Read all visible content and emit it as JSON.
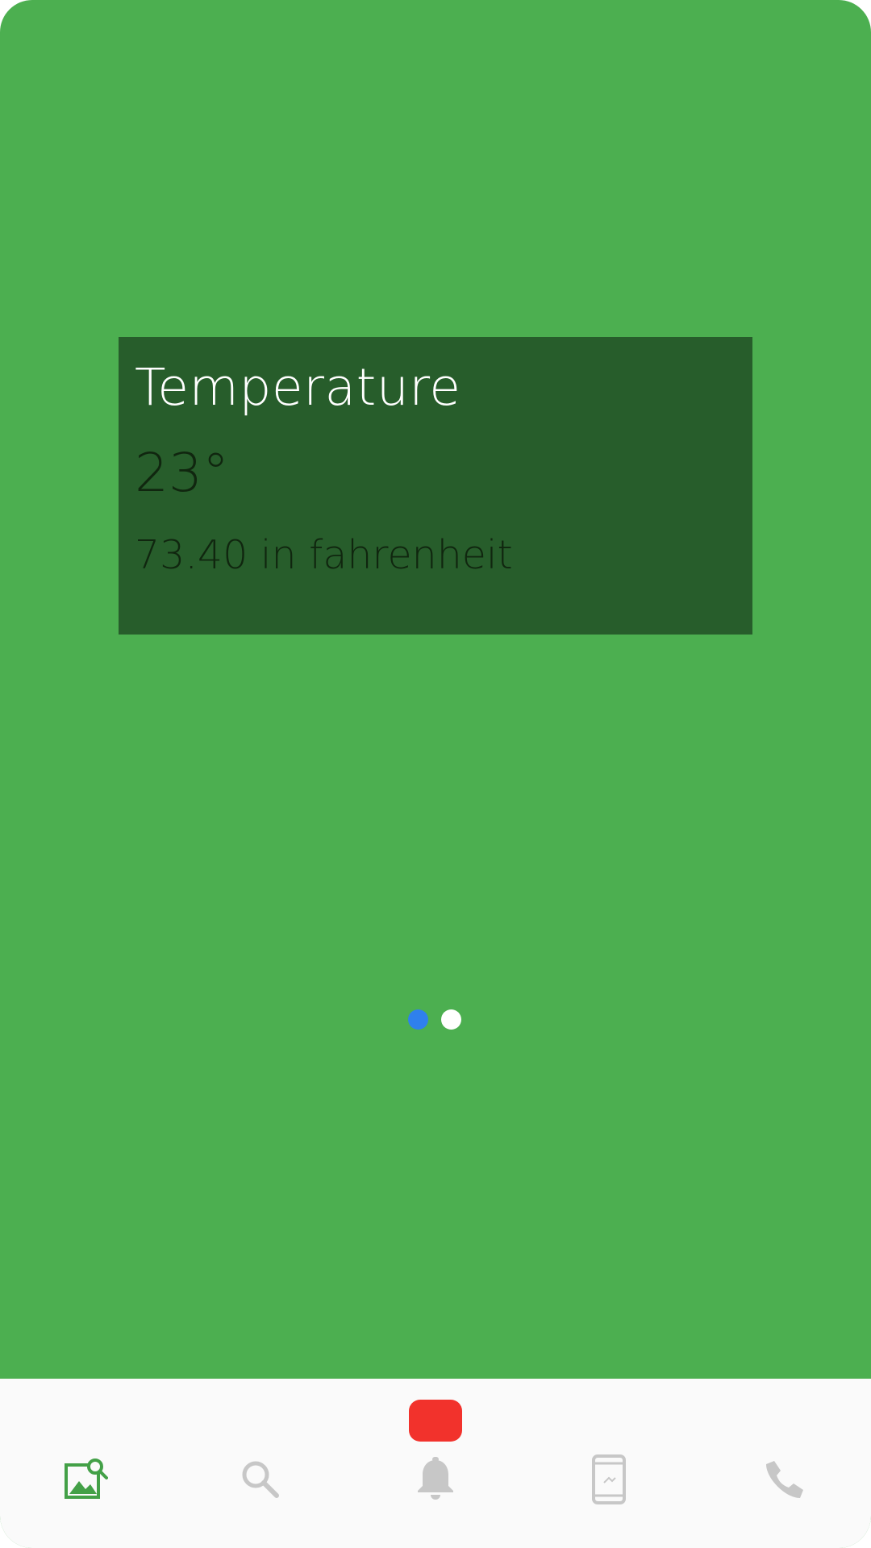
{
  "card": {
    "title": "Temperature",
    "value": "23°",
    "subtitle": "73.40 in fahrenheit"
  },
  "pager": {
    "total_pages": 2,
    "current_page": 1
  },
  "colors": {
    "background": "#4caf50",
    "card": "#275d2b",
    "dot_active": "#2f80ed",
    "dot_inactive": "#ffffff",
    "nav_active": "#43a047",
    "nav_inactive": "#c7c7c7",
    "notification_badge": "#f2322c"
  },
  "nav": {
    "items": [
      {
        "icon": "image-search-icon",
        "active": true
      },
      {
        "icon": "search-icon",
        "active": false
      },
      {
        "icon": "bell-icon",
        "active": false
      },
      {
        "icon": "phone-device-icon",
        "active": false
      },
      {
        "icon": "phone-call-icon",
        "active": false
      }
    ]
  }
}
